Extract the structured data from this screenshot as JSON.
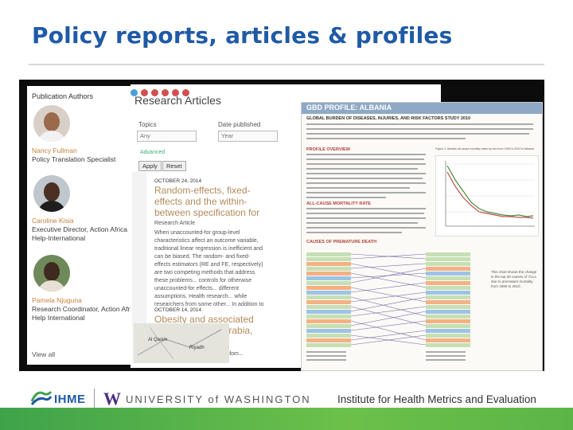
{
  "slide": {
    "title": "Policy reports, articles & profiles"
  },
  "authors": {
    "header": "Publication Authors",
    "people": [
      {
        "name": "Nancy Fullman",
        "role": "Policy Translation Specialist"
      },
      {
        "name": "Caroline Kisia",
        "role": "Executive Director, Action Africa Help-International"
      },
      {
        "name": "Pamela Njuguna",
        "role": "Research Coordinator, Action Africa Help International"
      }
    ],
    "view_all": "View all"
  },
  "articles": {
    "title": "Research Articles",
    "topics_label": "Topics",
    "topics_value": "Any",
    "date_label": "Date published",
    "date_value": "Year",
    "advanced": "Advanced",
    "apply": "Apply",
    "reset": "Reset",
    "items": [
      {
        "date": "OCTOBER 24, 2014",
        "title": "Random-effects, fixed-effects and the within-between specification for clustered data in observational health studies",
        "type": "Research Article",
        "snippet": "When unaccounted-for group-level characteristics affect an outcome variable, traditional linear regression is inefficient and can be biased. The random- and fixed-effects estimators (RE and FE, respectively) are two competing methods that address these problems... controls for otherwise unaccounted-for effects... different assumptions. Health research... while researchers from some other... In addition to RE and FE, an alternative... (WE) was suggested by Mundlak..."
      },
      {
        "date": "OCTOBER 14, 2014",
        "title": "Obesity and associated factors in Saudi Arabia, 2013",
        "type": "Research Article",
        "snippet": "Data on obesity from the Kingdom..."
      }
    ],
    "map_labels": [
      "Al Qasim",
      "Riyadh"
    ]
  },
  "gbd": {
    "header": "GBD PROFILE: ALBANIA",
    "subtitle": "GLOBAL BURDEN OF DISEASES, INJURIES, AND RISK FACTORS STUDY 2010",
    "sections": [
      "PROFILE OVERVIEW",
      "ALL-CAUSE MORTALITY RATE",
      "CAUSES OF PREMATURE DEATH"
    ],
    "chart_caption": "Figure 1: Median all-cause mortality rates by sex from 1990 to 2010 in Albania",
    "note": "This chart shows the change in the top 30 causes of YLLs due to premature mortality from 1990 to 2010."
  },
  "footer": {
    "ihme": "IHME",
    "uw": "UNIVERSITY of WASHINGTON",
    "institute": "Institute for Health Metrics and Evaluation"
  },
  "colors": {
    "title": "#1f5aa6",
    "accent_green": "#5cb547",
    "uw_purple": "#4b2e83"
  }
}
